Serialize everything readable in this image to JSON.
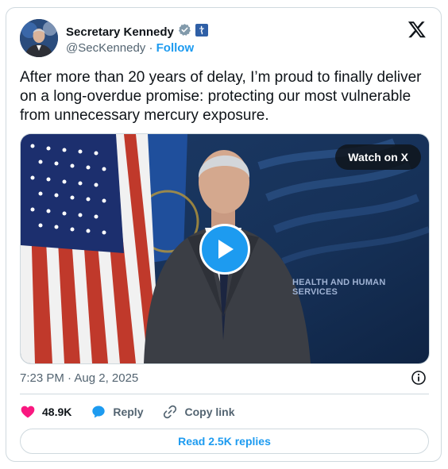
{
  "author": {
    "name": "Secretary Kennedy",
    "handle": "@SecKennedy",
    "separator": "·",
    "follow_label": "Follow"
  },
  "tweet": {
    "text": "After more than 20 years of delay, I’m proud to finally deliver on a long-overdue promise: protecting our most vulnerable from unnecessary mercury exposure."
  },
  "media": {
    "watch_label": "Watch on X",
    "background_text": "HEALTH AND HUMAN SERVICES"
  },
  "meta": {
    "timestamp": "7:23 PM · Aug 2, 2025"
  },
  "actions": {
    "like_count": "48.9K",
    "reply_label": "Reply",
    "copy_label": "Copy link"
  },
  "footer": {
    "read_replies_label": "Read 2.5K replies"
  },
  "colors": {
    "accent": "#1d9bf0",
    "like": "#f91880",
    "text": "#0f1419",
    "muted": "#536471",
    "border": "#cfd9de"
  }
}
